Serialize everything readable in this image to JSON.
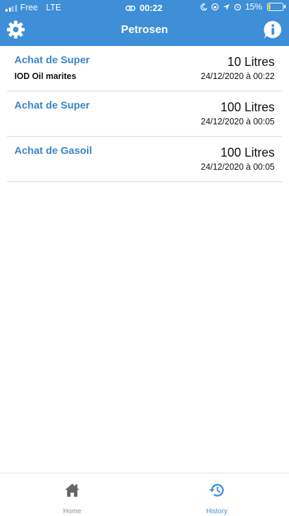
{
  "status_bar": {
    "carrier": "Free",
    "network": "LTE",
    "time": "00:22",
    "battery": "15%",
    "battery_level": 0.15
  },
  "header": {
    "title": "Petrosen",
    "settings_icon": "gear-icon",
    "info_icon": "info-icon"
  },
  "history": [
    {
      "fuel": "Achat de Super",
      "station": "IOD Oil marites",
      "quantity": "10 Litres",
      "date": "24/12/2020 à 00:22"
    },
    {
      "fuel": "Achat de Super",
      "station": "",
      "quantity": "100 Litres",
      "date": "24/12/2020 à 00:05"
    },
    {
      "fuel": "Achat de Gasoil",
      "station": "",
      "quantity": "100 Litres",
      "date": "24/12/2020 à 00:05"
    }
  ],
  "tabs": {
    "home": {
      "label": "Home",
      "icon": "home-icon"
    },
    "history": {
      "label": "History",
      "icon": "history-icon"
    }
  },
  "colors": {
    "primary": "#3e8ed8",
    "fuel_label": "#3d86c6",
    "inactive_tab": "#8e8e93"
  }
}
